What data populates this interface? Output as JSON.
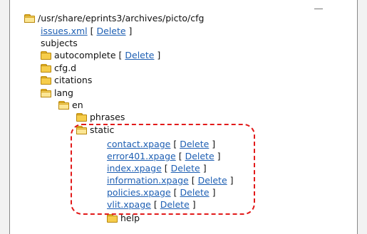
{
  "tree": {
    "root": {
      "path": "/usr/share/eprints3/archives/picto/cfg"
    },
    "delete_label": "Delete",
    "items": [
      {
        "type": "file",
        "name": "issues.xml"
      },
      {
        "type": "text",
        "name": "subjects"
      },
      {
        "type": "folder",
        "name": "autocomplete"
      },
      {
        "type": "folder",
        "name": "cfg.d"
      },
      {
        "type": "folder",
        "name": "citations"
      },
      {
        "type": "folder",
        "name": "lang"
      },
      {
        "type": "folder",
        "name": "en"
      },
      {
        "type": "folder",
        "name": "phrases"
      },
      {
        "type": "folder",
        "name": "static"
      },
      {
        "type": "file",
        "name": "contact.xpage"
      },
      {
        "type": "file",
        "name": "error401.xpage"
      },
      {
        "type": "file",
        "name": "index.xpage"
      },
      {
        "type": "file",
        "name": "information.xpage"
      },
      {
        "type": "file",
        "name": "policies.xpage"
      },
      {
        "type": "file",
        "name": "vlit.xpage"
      },
      {
        "type": "folder",
        "name": "help"
      }
    ]
  },
  "annotation": {
    "color": "#e21a1a",
    "style": "dashed"
  }
}
